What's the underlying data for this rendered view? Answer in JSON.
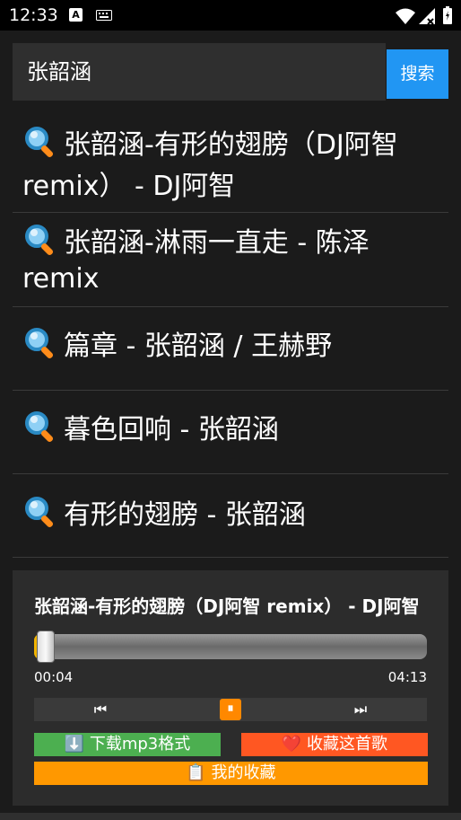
{
  "status_bar": {
    "time": "12:33"
  },
  "search": {
    "query": "张韶涵",
    "button_label": "搜索"
  },
  "results": [
    {
      "label": "张韶涵-有形的翅膀（DJ阿智 remix） - DJ阿智"
    },
    {
      "label": "张韶涵-淋雨一直走 - 陈泽 remix"
    },
    {
      "label": "篇章 - 张韶涵 / 王赫野"
    },
    {
      "label": "暮色回响 - 张韶涵"
    },
    {
      "label": "有形的翅膀 - 张韶涵"
    }
  ],
  "player": {
    "title": "张韶涵-有形的翅膀（DJ阿智 remix） - DJ阿智",
    "current_time": "00:04",
    "total_time": "04:13",
    "progress_fraction": 0.016,
    "controls": {
      "prev_icon": "⏮",
      "pause_icon": "⏸",
      "next_icon": "⏭"
    },
    "buttons": {
      "download": "⬇️ 下载mp3格式",
      "favorite": "❤️ 收藏这首歌",
      "my_favorites": "📋 我的收藏"
    }
  },
  "colors": {
    "accent": "#2196f3",
    "download": "#4caf50",
    "favorite": "#ff5722",
    "my_favorites": "#ff9800",
    "progress": "#f2b400"
  }
}
